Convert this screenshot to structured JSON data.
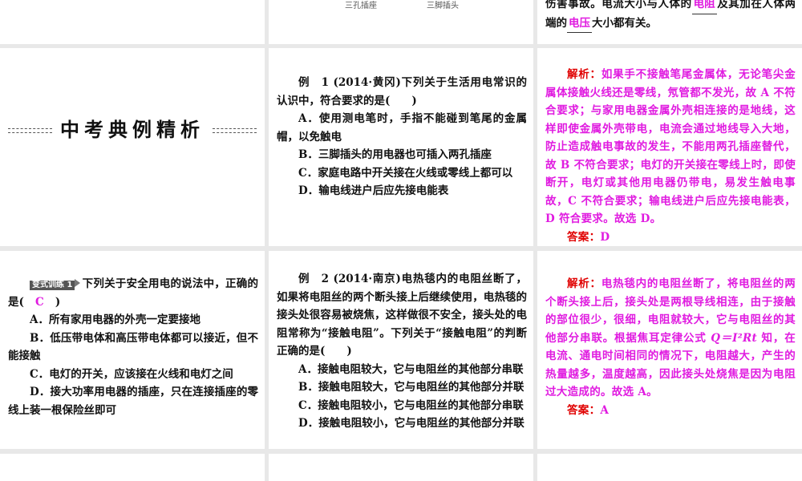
{
  "top": {
    "caption_socket": "三孔插座",
    "caption_plug": "三脚插头",
    "text_a": "伤害事故。电流大小与人体的",
    "blank1": "电阻",
    "text_b": "及其加在人体两端的",
    "blank2": "电压",
    "text_c": "大小都有关。"
  },
  "section_title": "中考典例精析",
  "example1": {
    "label": "例　1",
    "source": "(2014·黄冈)",
    "stem": "下列关于生活用电常识的认识中，符合要求的是(　　)",
    "options": [
      "A．使用测电笔时，手指不能碰到笔尾的金属帽，以免触电",
      "B．三脚插头的用电器也可插入两孔插座",
      "C．家庭电路中开关接在火线或零线上都可以",
      "D．输电线进户后应先接电能表"
    ],
    "analysis_label": "解析：",
    "analysis": "如果手不接触笔尾金属体，无论笔尖金属体接触火线还是零线，氖管都不发光，故 A 不符合要求；与家用电器金属外壳相连接的是地线，这样即使金属外壳带电，电流会通过地线导入大地，防止造成触电事故的发生，不能用两孔插座替代，故 B 不符合要求；电灯的开关接在零线上时，即使断开，电灯或其他用电器仍带电，易发生触电事故，C 不符合要求；输电线进户后应先接电能表，D 符合要求。故选 D。",
    "answer_label": "答案：",
    "answer": "D"
  },
  "exercise1": {
    "badge": "变式训练 1",
    "stem_a": "下列关于安全用电的说法中，正确的是(",
    "answer": "C",
    "stem_b": ")",
    "options": [
      "A．所有家用电器的外壳一定要接地",
      "B．低压带电体和高压带电体都可以接近，但不能接触",
      "C．电灯的开关，应该接在火线和电灯之间",
      "D．接大功率用电器的插座，只在连接插座的零线上装一根保险丝即可"
    ]
  },
  "example2": {
    "label": "例　2",
    "source": "(2014·南京)",
    "stem": "电热毯内的电阻丝断了，如果将电阻丝的两个断头接上后继续使用，电热毯的接头处很容易被烧焦，这样做很不安全，接头处的电阻常称为“接触电阻”。下列关于“接触电阻”的判断正确的是(　　)",
    "options": [
      "A．接触电阻较大，它与电阻丝的其他部分串联",
      "B．接触电阻较大，它与电阻丝的其他部分并联",
      "C．接触电阻较小，它与电阻丝的其他部分串联",
      "D．接触电阻较小，它与电阻丝的其他部分并联"
    ],
    "analysis_label": "解析：",
    "analysis_a": "电热毯内的电阻丝断了，将电阻丝的两个断头接上后，接头处是两根导线相连，由于接触的部位很少，很细，电阻就较大，它与电阻丝的其他部分串联。根据焦耳定律公式 ",
    "formula": "Q＝I²Rt",
    "analysis_b": " 知，在电流、通电时间相同的情况下，电阻越大，产生的热量越多，温度越高，因此接头处烧焦是因为电阻过大造成的。故选 A。",
    "answer_label": "答案：",
    "answer": "A"
  }
}
